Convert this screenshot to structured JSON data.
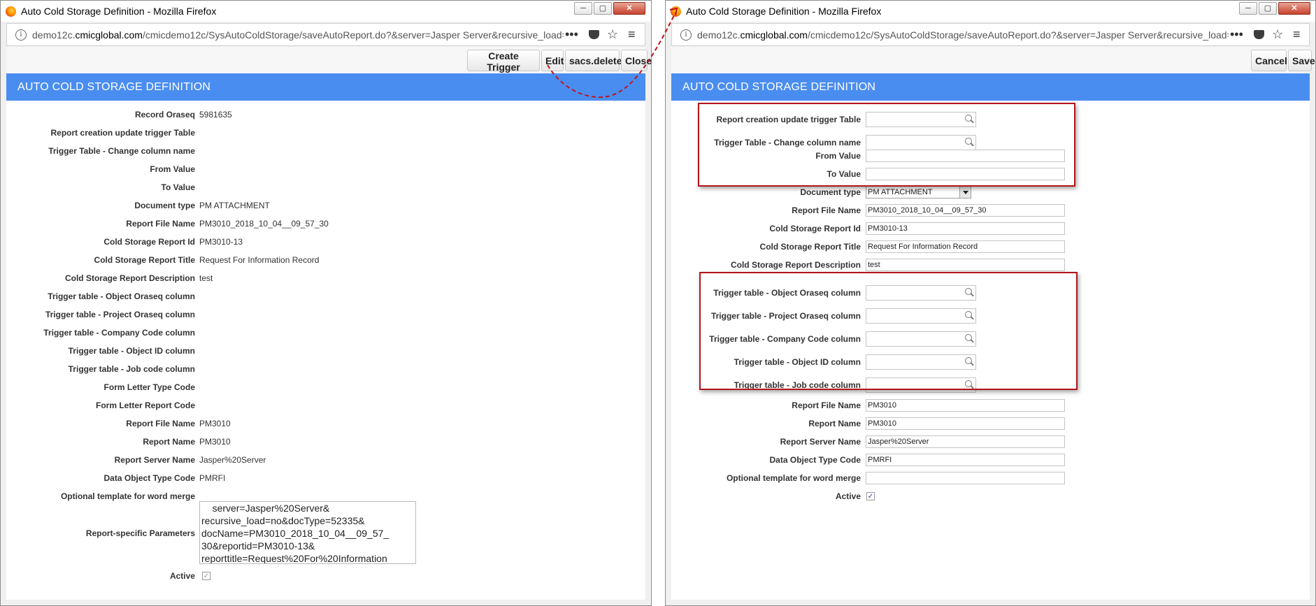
{
  "left_window": {
    "title": "Auto Cold Storage Definition - Mozilla Firefox",
    "url_prefix": "demo12c.",
    "url_domain": "cmicglobal.com",
    "url_path": "/cmicdemo12c/SysAutoColdStorage/saveAutoReport.do?&server=Jasper Server&recursive_load=",
    "toolbar": {
      "create_trigger": "Create Trigger",
      "edit": "Edit",
      "delete": "sacs.delete",
      "close": "Close"
    },
    "header": "AUTO COLD STORAGE DEFINITION",
    "fields": [
      {
        "label": "Record Oraseq",
        "value": "5981635"
      },
      {
        "label": "Report creation update trigger Table",
        "value": ""
      },
      {
        "label": "Trigger Table - Change column name",
        "value": ""
      },
      {
        "label": "From Value",
        "value": ""
      },
      {
        "label": "To Value",
        "value": ""
      },
      {
        "label": "Document type",
        "value": "PM ATTACHMENT"
      },
      {
        "label": "Report File Name",
        "value": "PM3010_2018_10_04__09_57_30"
      },
      {
        "label": "Cold Storage Report Id",
        "value": "PM3010-13"
      },
      {
        "label": "Cold Storage Report Title",
        "value": "Request For Information Record"
      },
      {
        "label": "Cold Storage Report Description",
        "value": "test"
      },
      {
        "label": "Trigger table - Object Oraseq column",
        "value": ""
      },
      {
        "label": "Trigger table - Project Oraseq column",
        "value": ""
      },
      {
        "label": "Trigger table - Company Code column",
        "value": ""
      },
      {
        "label": "Trigger table - Object ID column",
        "value": ""
      },
      {
        "label": "Trigger table - Job code column",
        "value": ""
      },
      {
        "label": "Form Letter Type Code",
        "value": ""
      },
      {
        "label": "Form Letter Report Code",
        "value": ""
      },
      {
        "label": "Report File Name",
        "value": "PM3010"
      },
      {
        "label": "Report Name",
        "value": "PM3010"
      },
      {
        "label": "Report Server Name",
        "value": "Jasper%20Server"
      },
      {
        "label": "Data Object Type Code",
        "value": "PMRFI"
      },
      {
        "label": "Optional template for word merge",
        "value": ""
      }
    ],
    "params_label": "Report-specific Parameters",
    "params_value": "    server=Jasper%20Server&\nrecursive_load=no&docType=52335&\ndocName=PM3010_2018_10_04__09_57_\n30&reportid=PM3010-13&\nreporttitle=Request%20For%20Information",
    "active_label": "Active",
    "active_checked": true
  },
  "right_window": {
    "title": "Auto Cold Storage Definition - Mozilla Firefox",
    "url_prefix": "demo12c.",
    "url_domain": "cmicglobal.com",
    "url_path": "/cmicdemo12c/SysAutoColdStorage/saveAutoReport.do?&server=Jasper Server&recursive_load=",
    "toolbar": {
      "cancel": "Cancel",
      "save": "Save"
    },
    "header": "AUTO COLD STORAGE DEFINITION",
    "lookup_group_1": [
      {
        "label": "Report creation update trigger Table",
        "value": ""
      },
      {
        "label": "Trigger Table - Change column name",
        "value": ""
      }
    ],
    "text_group_1": [
      {
        "label": "From Value",
        "value": ""
      },
      {
        "label": "To Value",
        "value": ""
      }
    ],
    "document_type": {
      "label": "Document type",
      "value": "PM ATTACHMENT"
    },
    "text_group_2": [
      {
        "label": "Report File Name",
        "value": "PM3010_2018_10_04__09_57_30"
      },
      {
        "label": "Cold Storage Report Id",
        "value": "PM3010-13"
      },
      {
        "label": "Cold Storage Report Title",
        "value": "Request For Information Record"
      },
      {
        "label": "Cold Storage Report Description",
        "value": "test"
      }
    ],
    "lookup_group_2": [
      {
        "label": "Trigger table - Object Oraseq column",
        "value": ""
      },
      {
        "label": "Trigger table - Project Oraseq column",
        "value": ""
      },
      {
        "label": "Trigger table - Company Code column",
        "value": ""
      },
      {
        "label": "Trigger table - Object ID column",
        "value": ""
      },
      {
        "label": "Trigger table - Job code column",
        "value": ""
      }
    ],
    "text_group_3": [
      {
        "label": "Report File Name",
        "value": "PM3010"
      },
      {
        "label": "Report Name",
        "value": "PM3010"
      },
      {
        "label": "Report Server Name",
        "value": "Jasper%20Server"
      },
      {
        "label": "Data Object Type Code",
        "value": "PMRFI"
      },
      {
        "label": "Optional template for word merge",
        "value": ""
      }
    ],
    "active_label": "Active",
    "active_checked": true
  },
  "colors": {
    "header_bg": "#4a8df0",
    "highlight_box": "#b3151c",
    "connector": "#c0141c"
  },
  "icons": [
    "firefox-logo",
    "info-icon",
    "more-icon",
    "pocket-icon",
    "bookmark-star-icon",
    "menu-icon",
    "search-icon",
    "minimize-icon",
    "maximize-icon",
    "close-icon"
  ]
}
